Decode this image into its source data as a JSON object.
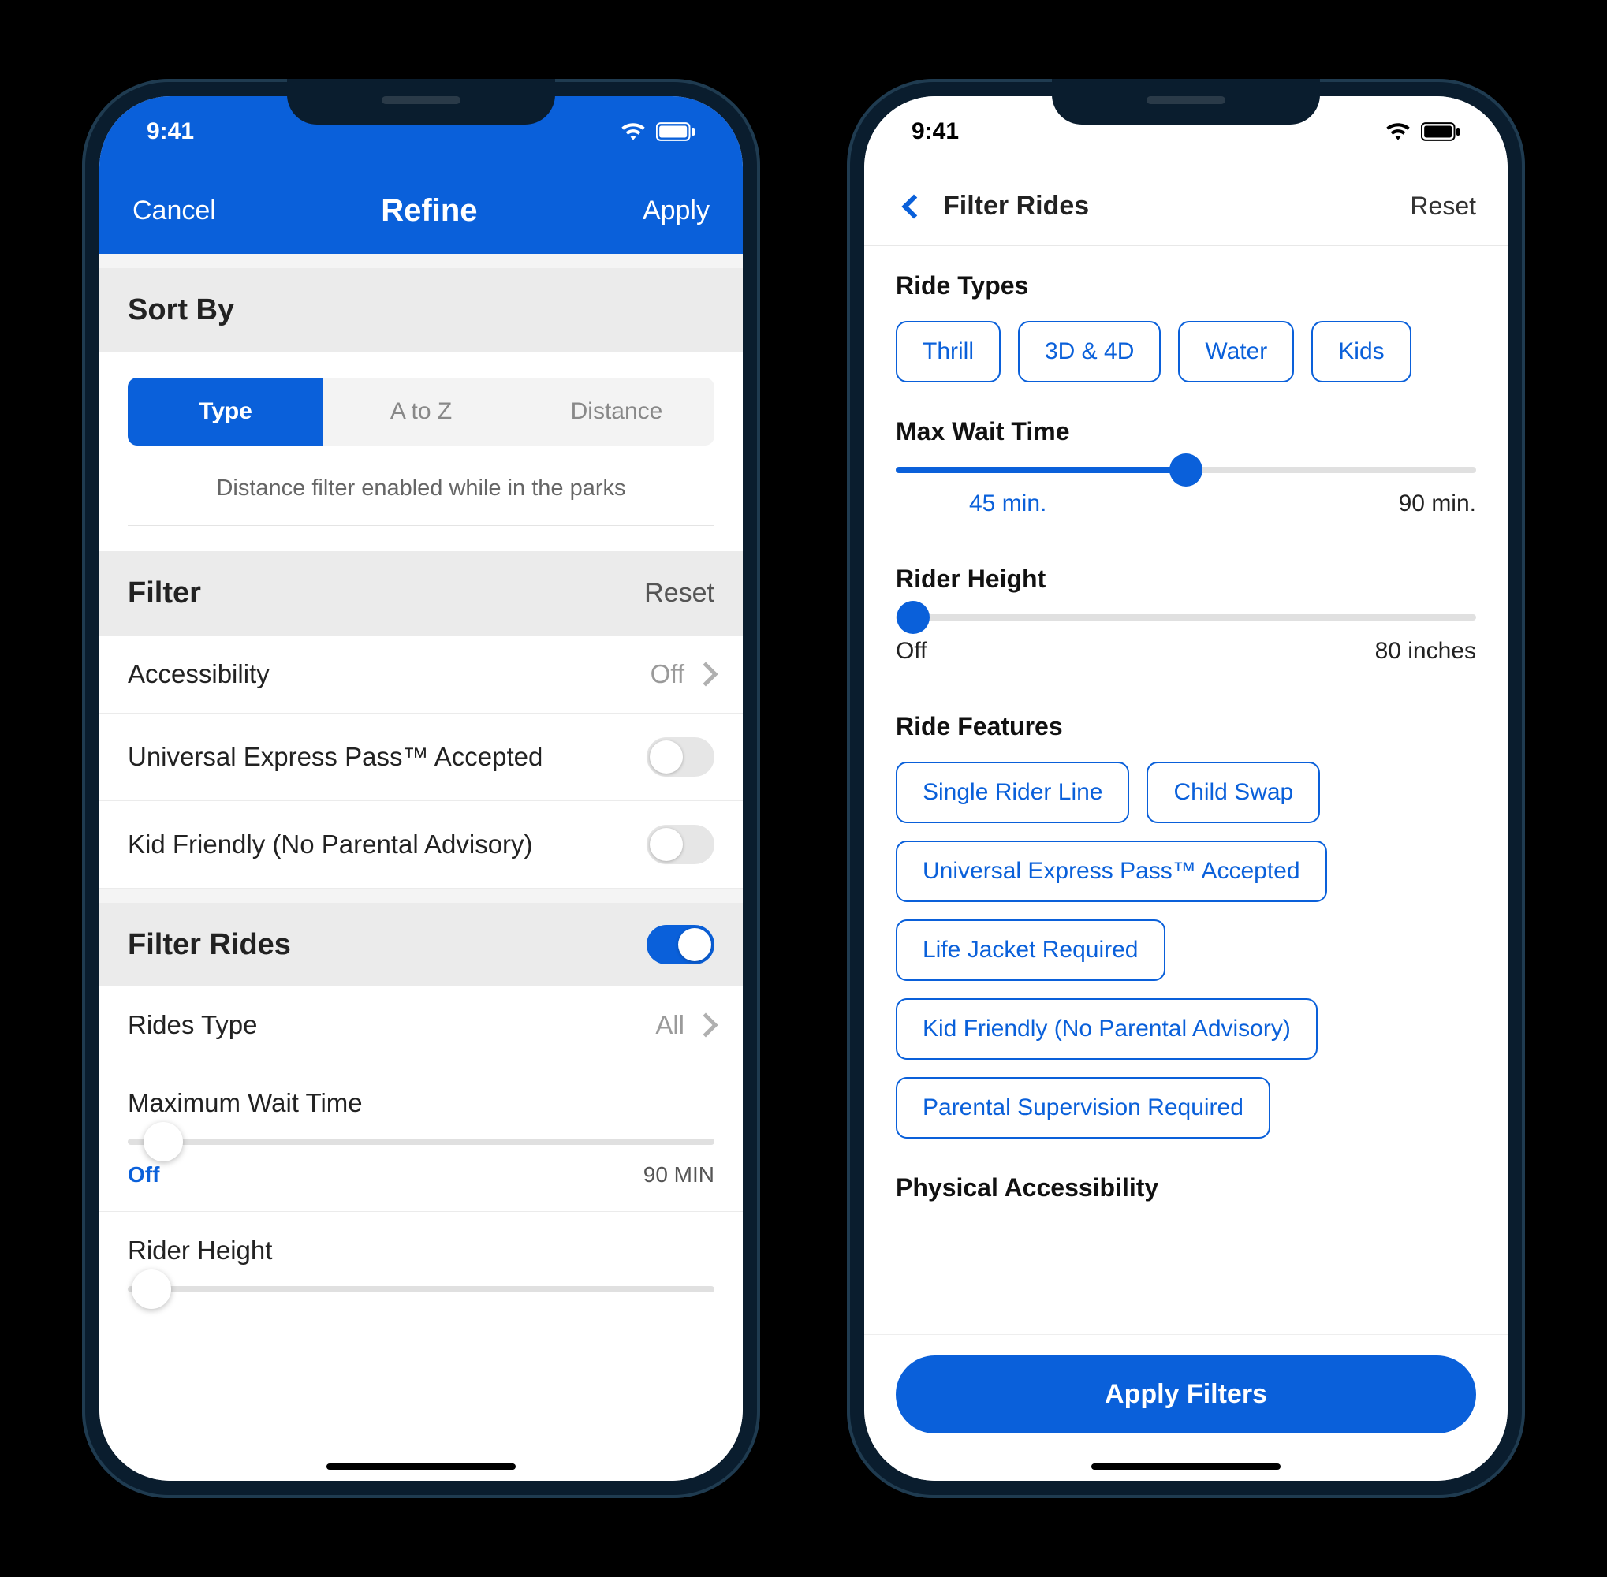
{
  "status": {
    "time": "9:41"
  },
  "colors": {
    "accent": "#0a60da"
  },
  "phone1": {
    "nav": {
      "left": "Cancel",
      "title": "Refine",
      "right": "Apply"
    },
    "sort": {
      "header": "Sort By",
      "segments": [
        "Type",
        "A to Z",
        "Distance"
      ],
      "active_index": 0,
      "hint": "Distance filter enabled while in the parks"
    },
    "filter": {
      "header": "Filter",
      "reset": "Reset",
      "rows": {
        "accessibility": {
          "label": "Accessibility",
          "value": "Off"
        },
        "express": {
          "label": "Universal Express Pass™ Accepted",
          "on": false
        },
        "kid": {
          "label": "Kid Friendly (No Parental Advisory)",
          "on": false
        }
      }
    },
    "rides": {
      "header": "Filter Rides",
      "on": true,
      "type": {
        "label": "Rides Type",
        "value": "All"
      },
      "wait": {
        "label": "Maximum Wait Time",
        "min_label": "Off",
        "max_label": "90 MIN",
        "position_pct": 6
      },
      "height": {
        "label": "Rider Height"
      }
    }
  },
  "phone2": {
    "nav": {
      "title": "Filter Rides",
      "reset": "Reset"
    },
    "ride_types": {
      "label": "Ride Types",
      "chips": [
        "Thrill",
        "3D & 4D",
        "Water",
        "Kids"
      ]
    },
    "wait": {
      "label": "Max Wait Time",
      "value_label": "45 min.",
      "max_label": "90 min.",
      "position_pct": 50
    },
    "height": {
      "label": "Rider Height",
      "min_label": "Off",
      "max_label": "80 inches",
      "position_pct": 3
    },
    "features": {
      "label": "Ride Features",
      "chips": [
        "Single Rider Line",
        "Child Swap",
        "Universal Express Pass™ Accepted",
        "Life Jacket Required",
        "Kid Friendly (No Parental Advisory)",
        "Parental Supervision Required"
      ]
    },
    "accessibility_label": "Physical Accessibility",
    "apply_label": "Apply Filters"
  }
}
